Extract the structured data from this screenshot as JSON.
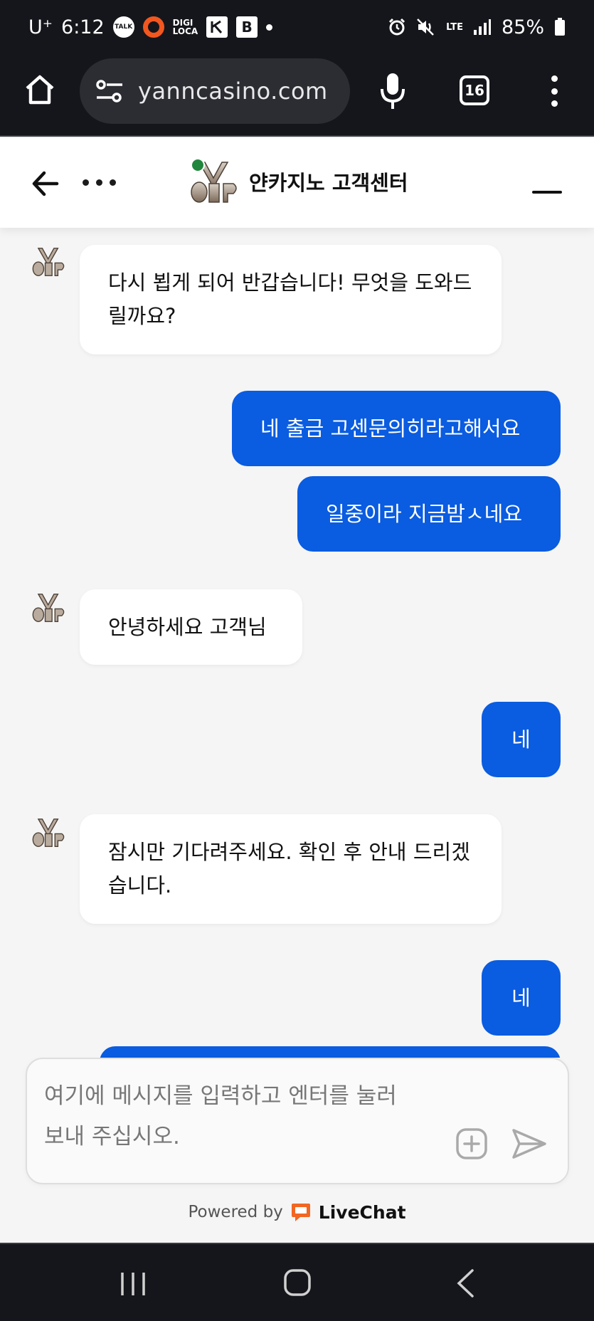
{
  "status_bar": {
    "carrier": "U⁺",
    "time": "6:12",
    "talk_badge": "TALK",
    "digi_line1": "DIGI",
    "digi_line2": "LOCA",
    "b_badge": "B",
    "network": "LTE",
    "battery": "85%"
  },
  "browser": {
    "url": "yanncasino.com",
    "tab_count": "16"
  },
  "chat_header": {
    "title": "얀카지노 고객센터"
  },
  "messages": [
    {
      "author": "agent",
      "text": "다시 뵙게 되어 반갑습니다! 무엇을 도와드릴까요?"
    },
    {
      "author": "visitor",
      "text": "네 출금 고센문의히라고해서요"
    },
    {
      "author": "visitor",
      "text": "일중이라 지금밤ㅅ네요"
    },
    {
      "author": "agent",
      "text": "안녕하세요 고객님"
    },
    {
      "author": "visitor",
      "text": "네"
    },
    {
      "author": "agent",
      "text": "잠시만 기다려주세요. 확인 후 안내 드리겠습니다."
    },
    {
      "author": "visitor",
      "text": "네"
    }
  ],
  "composer": {
    "placeholder": "여기에 메시지를 입력하고 엔터를 눌러 보내 주십시오."
  },
  "footer": {
    "powered_by": "Powered by",
    "brand": "LiveChat"
  },
  "colors": {
    "visitor_bubble": "#0a5ce0",
    "online_dot": "#21863d",
    "livechat_orange": "#f26722"
  }
}
